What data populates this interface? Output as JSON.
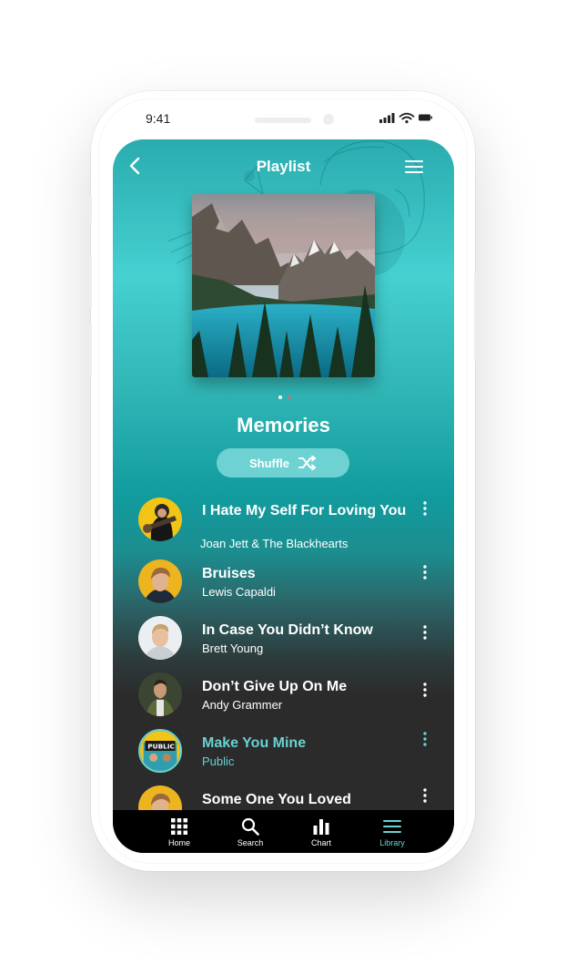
{
  "status_bar": {
    "time": "9:41"
  },
  "header": {
    "title": "Playlist"
  },
  "playlist": {
    "name": "Memories",
    "shuffle_label": "Shuffle"
  },
  "songs": [
    {
      "title": "I Hate My Self For Loving You",
      "artist": "Joan Jett & The Blackhearts",
      "active": false
    },
    {
      "title": "Bruises",
      "artist": "Lewis Capaldi",
      "active": false
    },
    {
      "title": "In Case You Didn’t Know",
      "artist": "Brett Young",
      "active": false
    },
    {
      "title": "Don’t Give Up On Me",
      "artist": "Andy Grammer",
      "active": false
    },
    {
      "title": "Make You Mine",
      "artist": "Public",
      "active": true
    },
    {
      "title": "Some One You Loved",
      "artist": "",
      "active": false
    }
  ],
  "tabs": [
    {
      "label": "Home",
      "icon": "grid-icon"
    },
    {
      "label": "Search",
      "icon": "search-icon"
    },
    {
      "label": "Chart",
      "icon": "bar-chart-icon"
    },
    {
      "label": "Library",
      "icon": "menu-lines-icon"
    }
  ],
  "colors": {
    "accent": "#69d1d1",
    "shuffle_bg": "#6fd2d2",
    "teal": "#46d0d0",
    "list_bg": "#2b2b2b",
    "tab_bg": "#000000"
  },
  "pager": {
    "page": 1,
    "of": 2
  }
}
